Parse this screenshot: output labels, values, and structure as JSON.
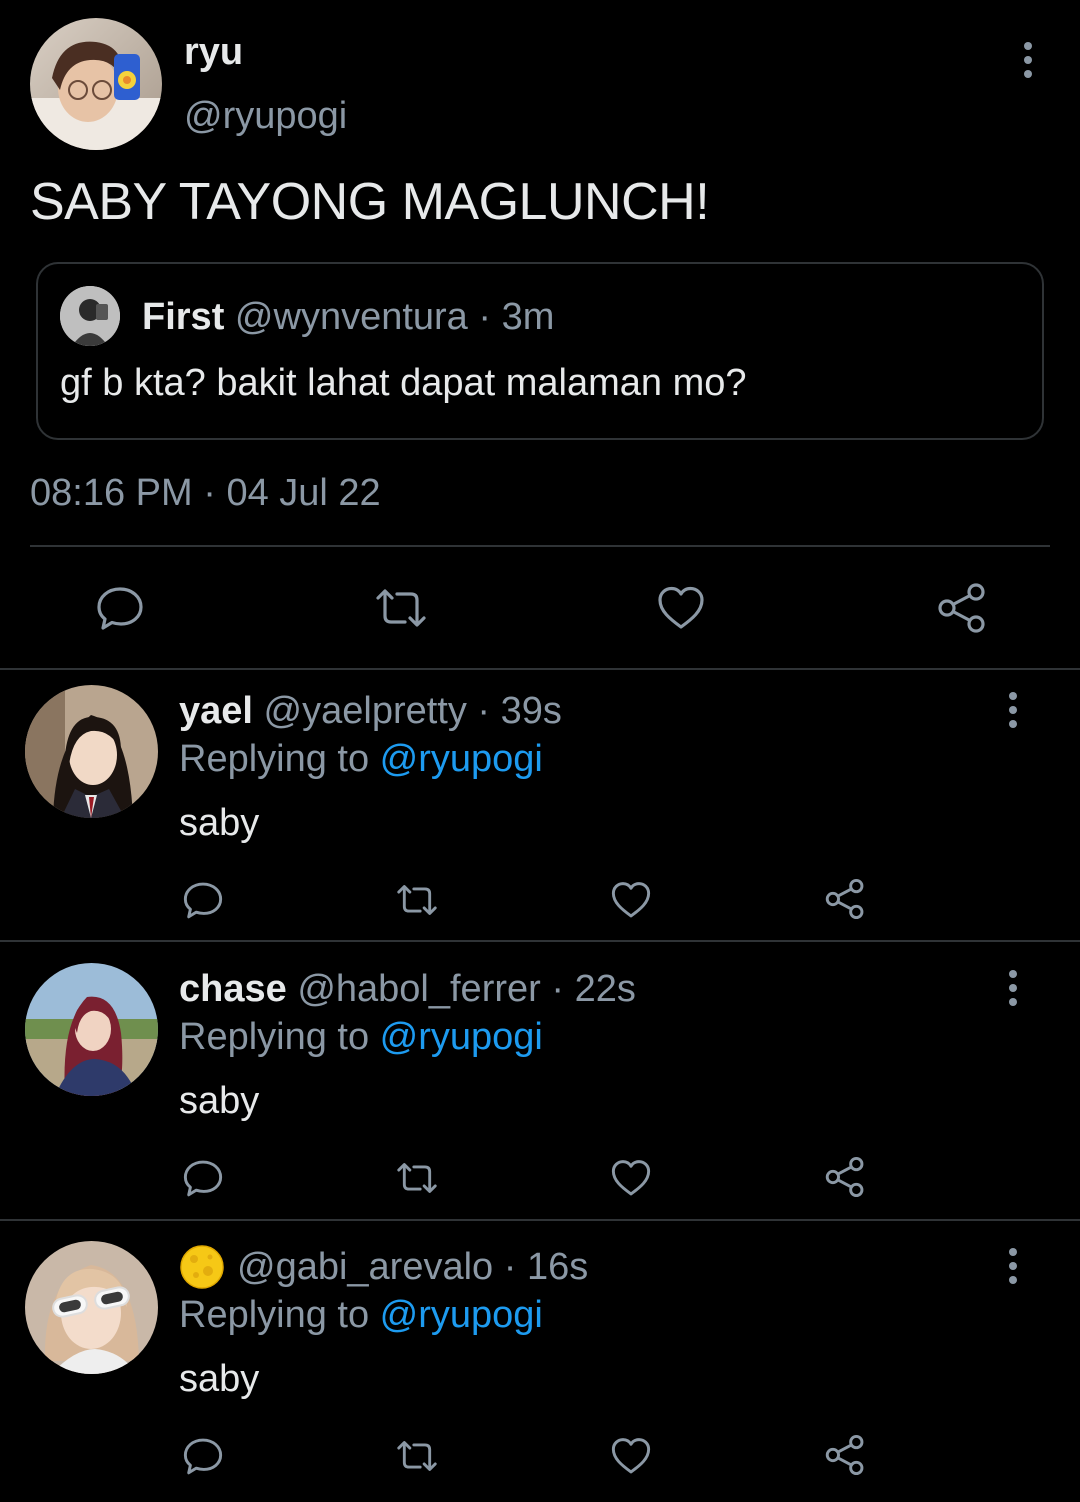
{
  "main_tweet": {
    "name": "ryu",
    "handle": "@ryupogi",
    "text": "SABY TAYONG MAGLUNCH!",
    "quote": {
      "name": "First",
      "handle": "@wynventura",
      "separator": "·",
      "time": "3m",
      "text": "gf b kta? bakit lahat dapat malaman mo?"
    },
    "time": "08:16 PM",
    "separator": "·",
    "date": "04 Jul 22"
  },
  "replies": [
    {
      "name": "yael",
      "handle": "@yaelpretty",
      "separator": "·",
      "time": "39s",
      "replying_prefix": "Replying to ",
      "replying_to": "@ryupogi",
      "text": "saby"
    },
    {
      "name": "chase",
      "handle": "@habol_ferrer",
      "separator": "·",
      "time": "22s",
      "replying_prefix": "Replying to ",
      "replying_to": "@ryupogi",
      "text": "saby"
    },
    {
      "name": "",
      "name_emoji": "moon-emoji-icon",
      "handle": "@gabi_arevalo",
      "separator": "·",
      "time": "16s",
      "replying_prefix": "Replying to ",
      "replying_to": "@ryupogi",
      "text": "saby"
    }
  ],
  "colors": {
    "background": "#000000",
    "text": "#e7e9ea",
    "secondary": "#8b98a5",
    "accent": "#1d9bf0",
    "divider": "#2f3336"
  },
  "icons": [
    "reply-icon",
    "retweet-icon",
    "like-icon",
    "share-icon",
    "more-icon"
  ]
}
